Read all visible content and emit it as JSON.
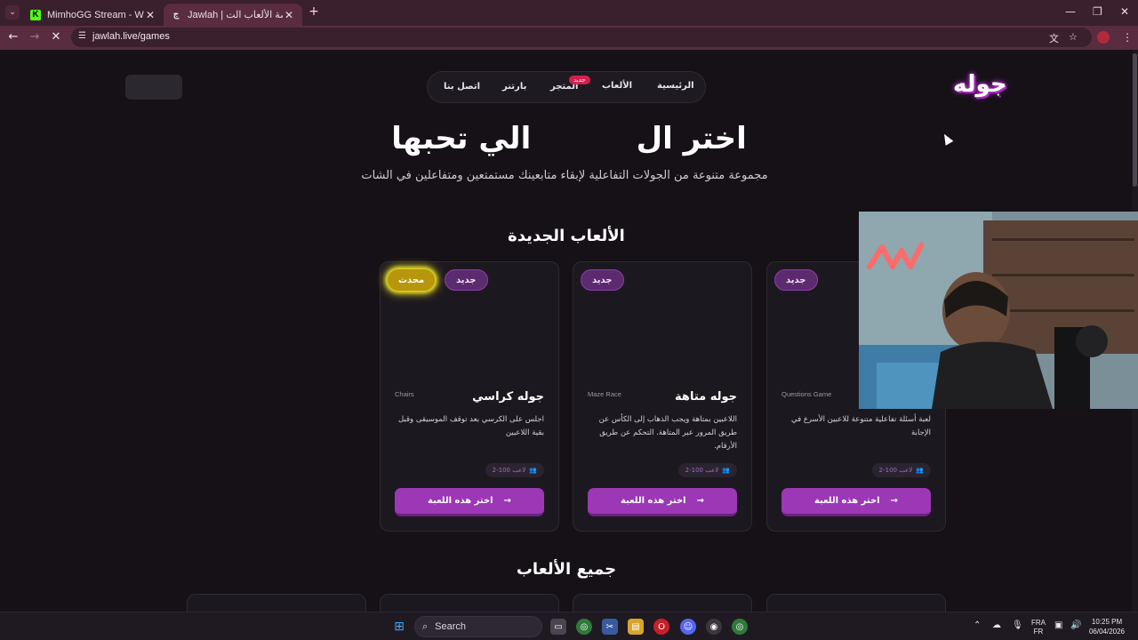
{
  "browser": {
    "tabs": [
      {
        "title": "MimhoGG Stream - Watch Live",
        "favicon": "kick-logo",
        "active": false
      },
      {
        "title": "Jawlah | جوله - منصة الألعاب الت",
        "favicon": "jawlah-logo",
        "active": true
      }
    ],
    "url": "jawlah.live/games",
    "accent": "#5a2c40"
  },
  "site": {
    "logo_text": "جوله",
    "nav": {
      "home": "الرئيسية",
      "games": "الألعاب",
      "store": "المتجر",
      "store_badge": "جديد",
      "partner": "بارتنر",
      "contact": "اتصل بنا"
    },
    "hero": {
      "title": "اختر ال          الي تحبها",
      "subtitle": "مجموعة متنوعة من الجولات التفاعلية لإبقاء متابعينك مستمتعين ومتفاعلين في الشات"
    },
    "new_games_title": "الألعاب الجديدة",
    "all_games_title": "جميع الألعاب",
    "cards": [
      {
        "badge_new": "جديد",
        "title": "",
        "tag": "Questions Game",
        "desc": "لعبة أسئلة تفاعلية متنوعة للاعبين الأسرع في الإجابة",
        "players": "2-100 لاعب",
        "button": "اختر هذه اللعبة"
      },
      {
        "badge_new": "جديد",
        "title": "جوله متاهة",
        "tag": "Maze Race",
        "desc": "اللاعبين بمتاهة ويجب الذهاب إلى الكأس عن طريق المرور عبر المتاهة. التحكم عن طريق الأرقام.",
        "players": "2-100 لاعب",
        "button": "اختر هذه اللعبة"
      },
      {
        "badge_new": "جديد",
        "badge_updated": "محدث",
        "title": "جوله كراسي",
        "tag": "Chairs",
        "desc": "اجلس على الكرسي بعد توقف الموسيقى وقبل بقية اللاعبين",
        "players": "2-100 لاعب",
        "button": "اختر هذه اللعبة"
      }
    ],
    "colors": {
      "background": "#151117",
      "card": "#1c181f",
      "button": "#9c37b6",
      "badge_new": "#5c2a6f",
      "badge_updated": "#b8960c"
    }
  },
  "taskbar": {
    "search_placeholder": "Search",
    "language": "FRA",
    "layout": "FR",
    "time": "10:25 PM",
    "date": "06/04/2026"
  }
}
